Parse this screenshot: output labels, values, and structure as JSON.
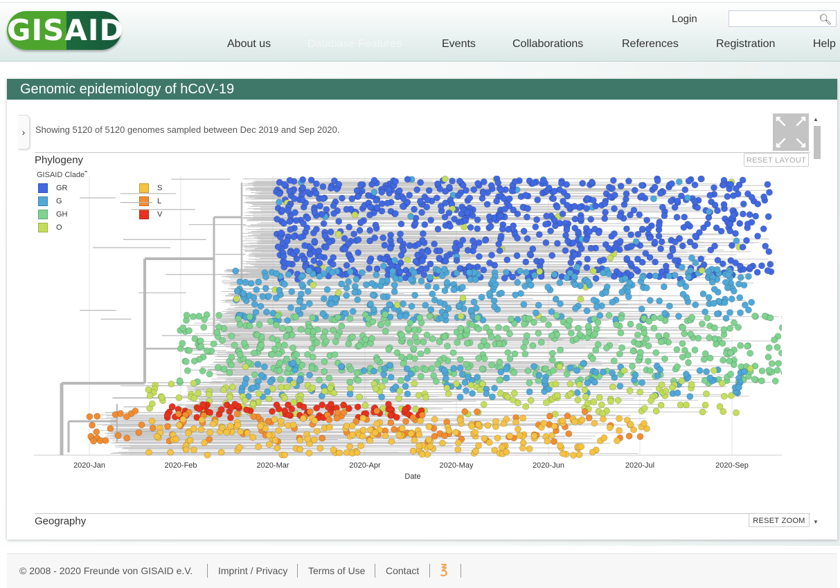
{
  "header": {
    "logo_text": "GISAID",
    "login": "Login",
    "search": {
      "value": "",
      "placeholder": ""
    },
    "nav": [
      "About us",
      "Database Features",
      "Events",
      "Collaborations",
      "References",
      "Registration",
      "Help"
    ],
    "active_nav": "Database Features"
  },
  "panel": {
    "title": "Genomic epidemiology of hCoV-19",
    "showing": "Showing 5120 of 5120 genomes sampled between Dec 2019 and Sep 2020.",
    "phylogeny_title": "Phylogeny",
    "reset_layout": "RESET LAYOUT",
    "geography_title": "Geography",
    "reset_zoom": "RESET ZOOM"
  },
  "legend": {
    "title": "GISAID Clade",
    "items": [
      {
        "label": "GR",
        "color": "#4169e1"
      },
      {
        "label": "G",
        "color": "#4fa8d8"
      },
      {
        "label": "GH",
        "color": "#7ed38f"
      },
      {
        "label": "O",
        "color": "#c4dd5a"
      },
      {
        "label": "S",
        "color": "#f5c242"
      },
      {
        "label": "L",
        "color": "#f28c30"
      },
      {
        "label": "V",
        "color": "#e8321e"
      }
    ]
  },
  "chart_data": {
    "type": "scatter",
    "title": "",
    "xlabel": "Date",
    "ylabel": "",
    "x_ticks": [
      "2020-Jan",
      "2020-Feb",
      "2020-Mar",
      "2020-Apr",
      "2020-May",
      "2020-Jun",
      "2020-Jul",
      "2020-Sep"
    ],
    "legend_position": "top-left",
    "series": [
      {
        "name": "GR",
        "color": "#4169e1"
      },
      {
        "name": "G",
        "color": "#4fa8d8"
      },
      {
        "name": "GH",
        "color": "#7ed38f"
      },
      {
        "name": "O",
        "color": "#c4dd5a"
      },
      {
        "name": "S",
        "color": "#f5c242"
      },
      {
        "name": "L",
        "color": "#f28c30"
      },
      {
        "name": "V",
        "color": "#e8321e"
      }
    ],
    "total_genomes": 5120
  },
  "footer": {
    "copyright": "© 2008 - 2020   Freunde von GISAID e.V.",
    "links": [
      "Imprint / Privacy",
      "Terms of Use",
      "Contact"
    ]
  }
}
